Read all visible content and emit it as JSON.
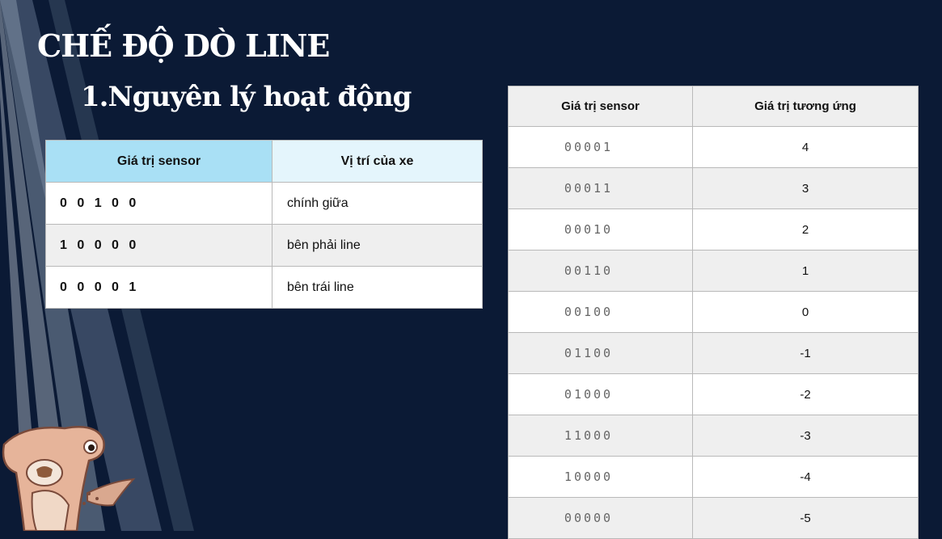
{
  "slide": {
    "title": "CHẾ ĐỘ DÒ LINE",
    "subtitle": "1.Nguyên lý hoạt động"
  },
  "table_left": {
    "headers": [
      "Giá trị sensor",
      "Vị trí của xe"
    ],
    "rows": [
      {
        "sensor": "0 0 1 0 0",
        "position": "chính giữa"
      },
      {
        "sensor": "1 0 0 0 0",
        "position": "bên phải line"
      },
      {
        "sensor": "0 0 0 0 1",
        "position": "bên trái line"
      }
    ]
  },
  "table_right": {
    "headers": [
      "Giá trị sensor",
      "Giá trị tương ứng"
    ],
    "rows": [
      {
        "sensor": "00001",
        "value": "4"
      },
      {
        "sensor": "00011",
        "value": "3"
      },
      {
        "sensor": "00010",
        "value": "2"
      },
      {
        "sensor": "00110",
        "value": "1"
      },
      {
        "sensor": "00100",
        "value": "0"
      },
      {
        "sensor": "01100",
        "value": "-1"
      },
      {
        "sensor": "01000",
        "value": "-2"
      },
      {
        "sensor": "11000",
        "value": "-3"
      },
      {
        "sensor": "10000",
        "value": "-4"
      },
      {
        "sensor": "00000",
        "value": "-5"
      }
    ]
  },
  "colors": {
    "background": "#0b1a35",
    "header_blue": "#a9e0f5",
    "header_light_blue": "#e4f5fc"
  }
}
